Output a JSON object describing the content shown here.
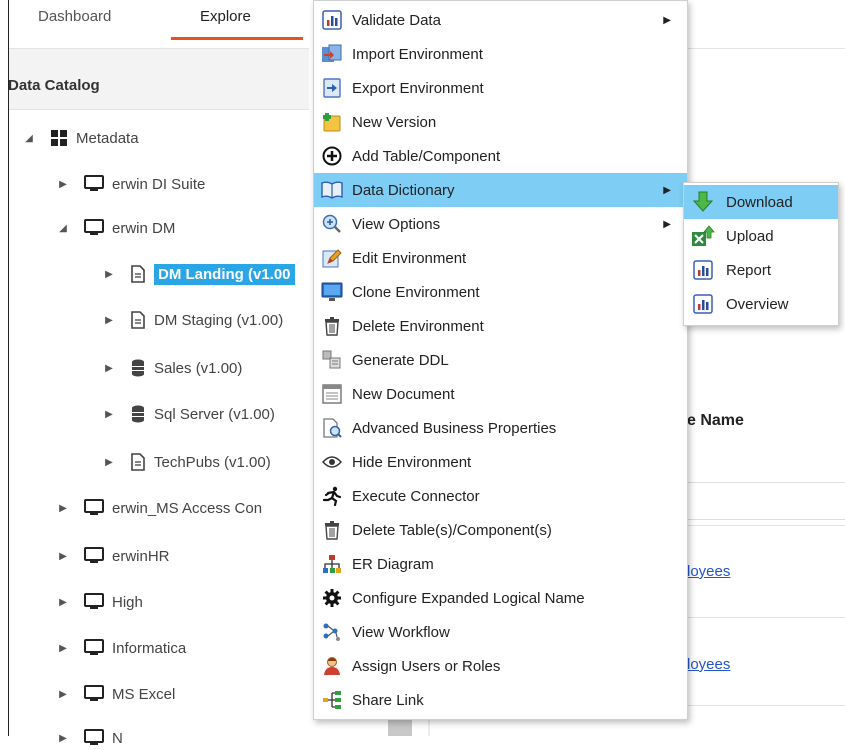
{
  "tabs": [
    {
      "label": "Dashboard"
    },
    {
      "label": "Explore"
    }
  ],
  "panel": {
    "title": "Data Catalog"
  },
  "tree": [
    {
      "label": "Metadata",
      "expanded": true,
      "icon": "grid-icon"
    },
    {
      "label": "erwin DI Suite",
      "expanded": false,
      "icon": "monitor-icon"
    },
    {
      "label": "erwin DM",
      "expanded": true,
      "icon": "monitor-icon"
    },
    {
      "label": "DM Landing (v1.00",
      "expanded": false,
      "icon": "document-icon",
      "selected": true
    },
    {
      "label": "DM Staging (v1.00)",
      "expanded": false,
      "icon": "document-icon"
    },
    {
      "label": "Sales (v1.00)",
      "expanded": false,
      "icon": "database-icon"
    },
    {
      "label": "Sql Server (v1.00)",
      "expanded": false,
      "icon": "database-icon"
    },
    {
      "label": "TechPubs (v1.00)",
      "expanded": false,
      "icon": "document-icon"
    },
    {
      "label": "erwin_MS Access Con",
      "expanded": false,
      "icon": "monitor-icon"
    },
    {
      "label": "erwinHR",
      "expanded": false,
      "icon": "monitor-icon"
    },
    {
      "label": "High",
      "expanded": false,
      "icon": "monitor-icon"
    },
    {
      "label": "Informatica",
      "expanded": false,
      "icon": "monitor-icon"
    },
    {
      "label": "MS Excel",
      "expanded": false,
      "icon": "monitor-icon"
    },
    {
      "label": "N",
      "expanded": false,
      "icon": "monitor-icon"
    }
  ],
  "context_menu": {
    "items": [
      {
        "label": "Validate Data",
        "icon": "bar-chart-icon",
        "submenu": true
      },
      {
        "label": "Import Environment",
        "icon": "import-icon"
      },
      {
        "label": "Export Environment",
        "icon": "export-icon"
      },
      {
        "label": "New Version",
        "icon": "new-version-icon"
      },
      {
        "label": "Add Table/Component",
        "icon": "add-circle-icon"
      },
      {
        "label": "Data Dictionary",
        "icon": "book-icon",
        "submenu": true,
        "highlighted": true
      },
      {
        "label": "View Options",
        "icon": "zoom-icon",
        "submenu": true
      },
      {
        "label": "Edit Environment",
        "icon": "edit-icon"
      },
      {
        "label": "Clone Environment",
        "icon": "clone-icon"
      },
      {
        "label": "Delete Environment",
        "icon": "trash-icon"
      },
      {
        "label": "Generate DDL",
        "icon": "generate-ddl-icon"
      },
      {
        "label": "New Document",
        "icon": "new-document-icon"
      },
      {
        "label": "Advanced Business Properties",
        "icon": "properties-icon"
      },
      {
        "label": "Hide Environment",
        "icon": "eye-icon"
      },
      {
        "label": "Execute Connector",
        "icon": "run-icon"
      },
      {
        "label": "Delete Table(s)/Component(s)",
        "icon": "trash-icon"
      },
      {
        "label": "ER Diagram",
        "icon": "hierarchy-icon"
      },
      {
        "label": "Configure Expanded Logical Name",
        "icon": "gear-icon"
      },
      {
        "label": "View Workflow",
        "icon": "workflow-icon"
      },
      {
        "label": "Assign Users or Roles",
        "icon": "user-icon"
      },
      {
        "label": "Share Link",
        "icon": "share-icon"
      }
    ]
  },
  "submenu": {
    "items": [
      {
        "label": "Download",
        "icon": "download-icon",
        "highlighted": true
      },
      {
        "label": "Upload",
        "icon": "upload-icon"
      },
      {
        "label": "Report",
        "icon": "bar-chart-icon"
      },
      {
        "label": "Overview",
        "icon": "bar-chart-icon"
      }
    ]
  },
  "background": {
    "column_header": "e Name",
    "links": [
      "loyees",
      "loyees"
    ]
  },
  "colors": {
    "accent": "#e8501e",
    "highlight": "#7ecdf4",
    "selection": "#2aa5e6"
  }
}
